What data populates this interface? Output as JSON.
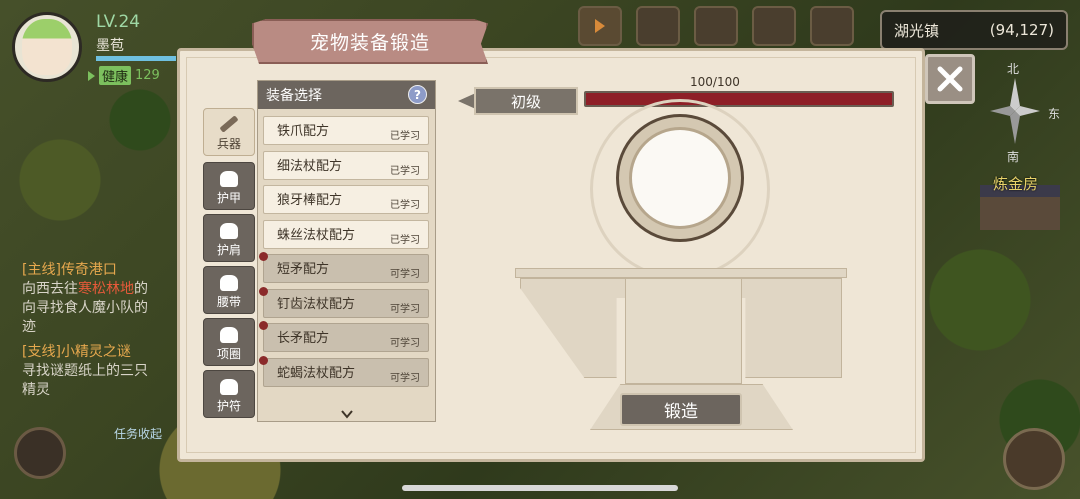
{
  "player": {
    "level": "LV.24",
    "name": "墨苞",
    "status": "健康",
    "hp": "129"
  },
  "location": {
    "name": "湖光镇",
    "coords": "(94,127)"
  },
  "compass": {
    "north": "北",
    "east": "东",
    "south": "南"
  },
  "map_labels": {
    "building": "炼金房"
  },
  "quests": {
    "main_tag": "[主线]",
    "main_title": "传奇港口",
    "main_desc_before": "向西去往",
    "main_desc_highlight": "寒松林地",
    "main_desc_after": "的",
    "main_desc_line2": "向寻找食人魔小队的",
    "main_desc_line3": "迹",
    "side_tag": "[支线]",
    "side_title": "小精灵之谜",
    "side_desc_line1": "寻找谜题纸上的三只",
    "side_desc_line2": "精灵",
    "collapse_label": "任务收起"
  },
  "dialog": {
    "title": "宠物装备锻造",
    "list_header": "装备选择",
    "help_label": "?",
    "grade_label": "初级",
    "progress_text": "100/100",
    "progress_fraction": 1.0,
    "forge_button": "锻造"
  },
  "tabs": [
    {
      "label": "兵器",
      "active": true
    },
    {
      "label": "护甲",
      "active": false
    },
    {
      "label": "护肩",
      "active": false
    },
    {
      "label": "腰带",
      "active": false
    },
    {
      "label": "项圈",
      "active": false
    },
    {
      "label": "护符",
      "active": false
    }
  ],
  "recipes": [
    {
      "name": "铁爪配方",
      "status": "已学习",
      "learned": true
    },
    {
      "name": "细法杖配方",
      "status": "已学习",
      "learned": true
    },
    {
      "name": "狼牙棒配方",
      "status": "已学习",
      "learned": true
    },
    {
      "name": "蛛丝法杖配方",
      "status": "已学习",
      "learned": true
    },
    {
      "name": "短矛配方",
      "status": "可学习",
      "learned": false
    },
    {
      "name": "钉齿法杖配方",
      "status": "可学习",
      "learned": false
    },
    {
      "name": "长矛配方",
      "status": "可学习",
      "learned": false
    },
    {
      "name": "蛇蝎法杖配方",
      "status": "可学习",
      "learned": false
    }
  ],
  "colors": {
    "progress_fill": "#8e1f27",
    "health": "#7cc05e",
    "level": "#9fd8a5"
  }
}
